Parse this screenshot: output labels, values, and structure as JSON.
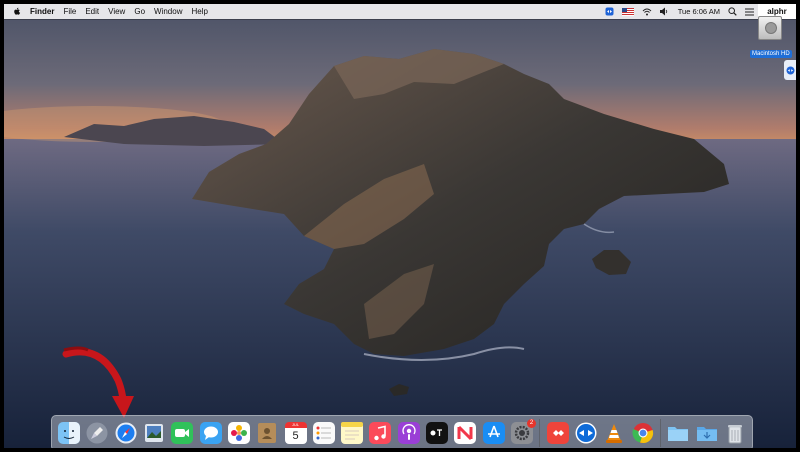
{
  "menubar": {
    "app_name": "Finder",
    "items": [
      "File",
      "Edit",
      "View",
      "Go",
      "Window",
      "Help"
    ],
    "clock": "Tue 6:06 AM",
    "brand": "alphr"
  },
  "desktop": {
    "disk_label": "Macintosh HD"
  },
  "dock": {
    "calendar_month": "JUL",
    "calendar_day": "5",
    "system_prefs_badge": "2",
    "apps": [
      "Finder",
      "Launchpad",
      "Safari",
      "Preview",
      "FaceTime",
      "Messages",
      "Photos",
      "Contacts",
      "Calendar",
      "Reminders",
      "Notes",
      "Music",
      "Podcasts",
      "TV",
      "News",
      "App Store",
      "System Preferences",
      "AnyDesk",
      "TeamViewer",
      "VLC",
      "Chrome",
      "Applications",
      "Downloads",
      "Trash"
    ]
  },
  "colors": {
    "menubar_bg": "#ececee",
    "dock_bg": "#d2d7e1",
    "arrow": "#c8161b",
    "selection_blue": "#1f6ed6"
  }
}
